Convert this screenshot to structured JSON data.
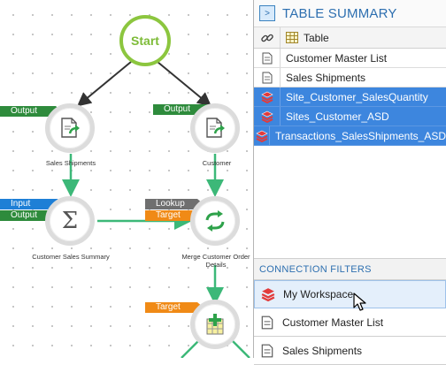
{
  "workflow": {
    "start_label": "Start",
    "nodes": [
      {
        "id": "sales-shipments",
        "label": "Sales Shipments",
        "tags": [
          "Output"
        ]
      },
      {
        "id": "customer",
        "label": "Customer",
        "tags": [
          "Output"
        ]
      },
      {
        "id": "customer-sales-summary",
        "label": "Customer Sales Summary",
        "tags": [
          "Input",
          "Output"
        ]
      },
      {
        "id": "merge-customer-order-details",
        "label": "Merge Customer Order Details",
        "tags": [
          "Lookup",
          "Target"
        ]
      },
      {
        "id": "bottom-node",
        "label": "",
        "tags": [
          "Target"
        ]
      }
    ]
  },
  "table_summary": {
    "title": "TABLE SUMMARY",
    "column_header": "Table",
    "rows": [
      {
        "name": "Customer Master List",
        "icon": "document-icon",
        "selected": false
      },
      {
        "name": "Sales Shipments",
        "icon": "document-icon",
        "selected": false
      },
      {
        "name": "Site_Customer_SalesQuantity",
        "icon": "stack-icon",
        "selected": true
      },
      {
        "name": "Sites_Customer_ASD",
        "icon": "stack-icon",
        "selected": true
      },
      {
        "name": "Transactions_SalesShipments_ASD",
        "icon": "stack-icon",
        "selected": true
      }
    ]
  },
  "connection_filters": {
    "title": "CONNECTION FILTERS",
    "items": [
      {
        "name": "My Workspace",
        "icon": "stack-icon",
        "hover": true
      },
      {
        "name": "Customer Master List",
        "icon": "document-icon",
        "hover": false
      },
      {
        "name": "Sales Shipments",
        "icon": "document-icon",
        "hover": false
      }
    ]
  },
  "colors": {
    "start_green": "#8cc63f",
    "output_tag": "#2e8b3c",
    "input_tag": "#1e7fd6",
    "lookup_tag": "#6f6f6f",
    "target_tag": "#f08a16",
    "selection": "#3d86de",
    "panel_title": "#2d6fb0"
  }
}
